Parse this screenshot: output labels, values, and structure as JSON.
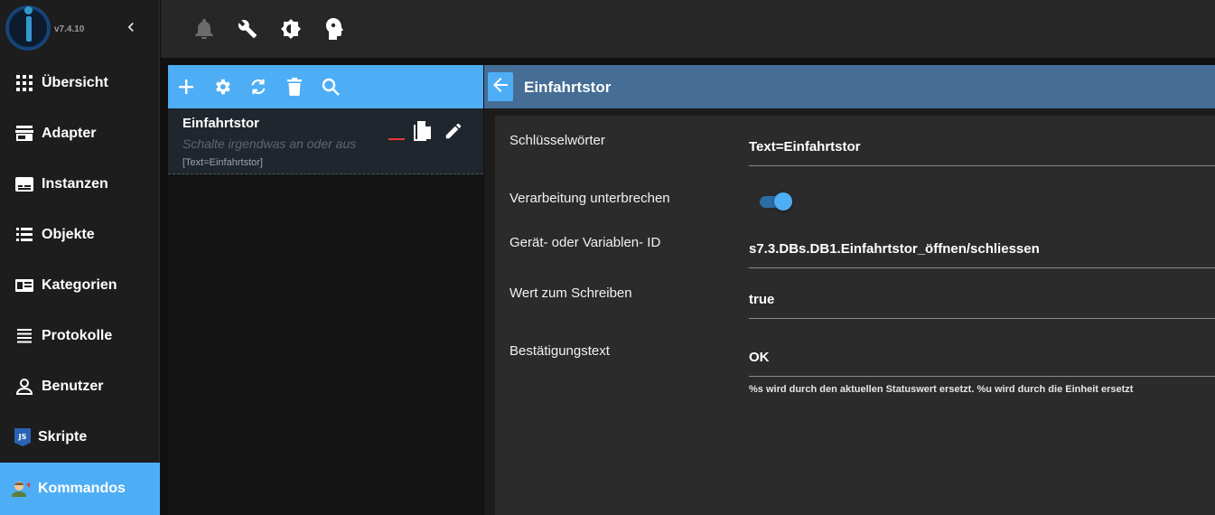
{
  "app": {
    "version": "v7.4.10",
    "collapse_icon": "chevron-left-icon"
  },
  "colors": {
    "accent": "#4eaef5",
    "header": "#466d96",
    "danger": "#e53935"
  },
  "sidebar": {
    "items": [
      {
        "label": "Übersicht",
        "icon": "apps-grid-icon",
        "active": false
      },
      {
        "label": "Adapter",
        "icon": "store-icon",
        "active": false
      },
      {
        "label": "Instanzen",
        "icon": "subtitles-icon",
        "active": false
      },
      {
        "label": "Objekte",
        "icon": "list-icon",
        "active": false
      },
      {
        "label": "Kategorien",
        "icon": "badge-icon",
        "active": false
      },
      {
        "label": "Protokolle",
        "icon": "lines-icon",
        "active": false
      },
      {
        "label": "Benutzer",
        "icon": "person-icon",
        "active": false
      },
      {
        "label": "Skripte",
        "icon": "js-icon",
        "active": false
      },
      {
        "label": "Kommandos",
        "icon": "person-speaking-icon",
        "active": true
      }
    ]
  },
  "topbar": {
    "icons": [
      "bell-icon",
      "wrench-icon",
      "brightness-icon",
      "head-profile-icon"
    ]
  },
  "list_toolbar": {
    "icons": [
      "add-icon",
      "settings-icon",
      "refresh-icon",
      "delete-icon",
      "search-icon"
    ]
  },
  "command_list": [
    {
      "title": "Einfahrtstor",
      "description": "Schalte irgendwas an oder aus",
      "keywords": "[Text=Einfahrtstor]"
    }
  ],
  "detail": {
    "title": "Einfahrtstor",
    "fields": {
      "keywords": {
        "label": "Schlüsselwörter",
        "value": "Text=Einfahrtstor"
      },
      "break": {
        "label": "Verarbeitung unterbrechen",
        "value": true
      },
      "device": {
        "label": "Gerät- oder Variablen- ID",
        "value": "s7.3.DBs.DB1.Einfahrtstor_öffnen/schliessen"
      },
      "write": {
        "label": "Wert zum Schreiben",
        "value": "true"
      },
      "ack": {
        "label": "Bestätigungstext",
        "value": "OK",
        "helper": "%s wird durch den aktuellen Statuswert ersetzt. %u wird durch die Einheit ersetzt"
      }
    }
  }
}
